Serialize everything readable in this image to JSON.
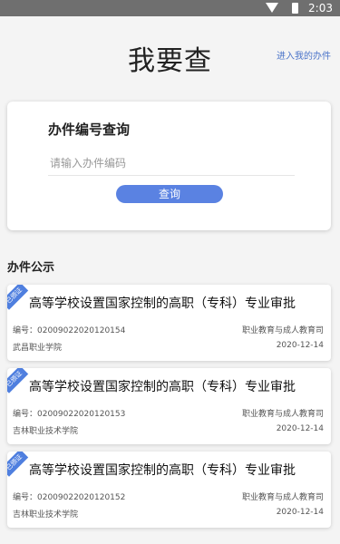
{
  "status_bar": {
    "time": "2:03"
  },
  "header": {
    "title": "我要查",
    "my_tasks_link": "进入我的办件"
  },
  "query": {
    "title": "办件编号查询",
    "placeholder": "请输入办件编码",
    "button_label": "查询"
  },
  "section": {
    "title": "办件公示"
  },
  "items": [
    {
      "badge": "已颁证",
      "title": "高等学校设置国家控制的高职（专科）专业审批",
      "code": "编号：02009022020120154",
      "dept": "职业教育与成人教育司",
      "school": "武昌职业学院",
      "date": "2020-12-14"
    },
    {
      "badge": "已颁证",
      "title": "高等学校设置国家控制的高职（专科）专业审批",
      "code": "编号：02009022020120153",
      "dept": "职业教育与成人教育司",
      "school": "吉林职业技术学院",
      "date": "2020-12-14"
    },
    {
      "badge": "已颁证",
      "title": "高等学校设置国家控制的高职（专科）专业审批",
      "code": "编号：02009022020120152",
      "dept": "职业教育与成人教育司",
      "school": "吉林职业技术学院",
      "date": "2020-12-14"
    }
  ],
  "colors": {
    "accent": "#5a82e2",
    "badge": "#4f7fdf",
    "link": "#4b74c9"
  }
}
